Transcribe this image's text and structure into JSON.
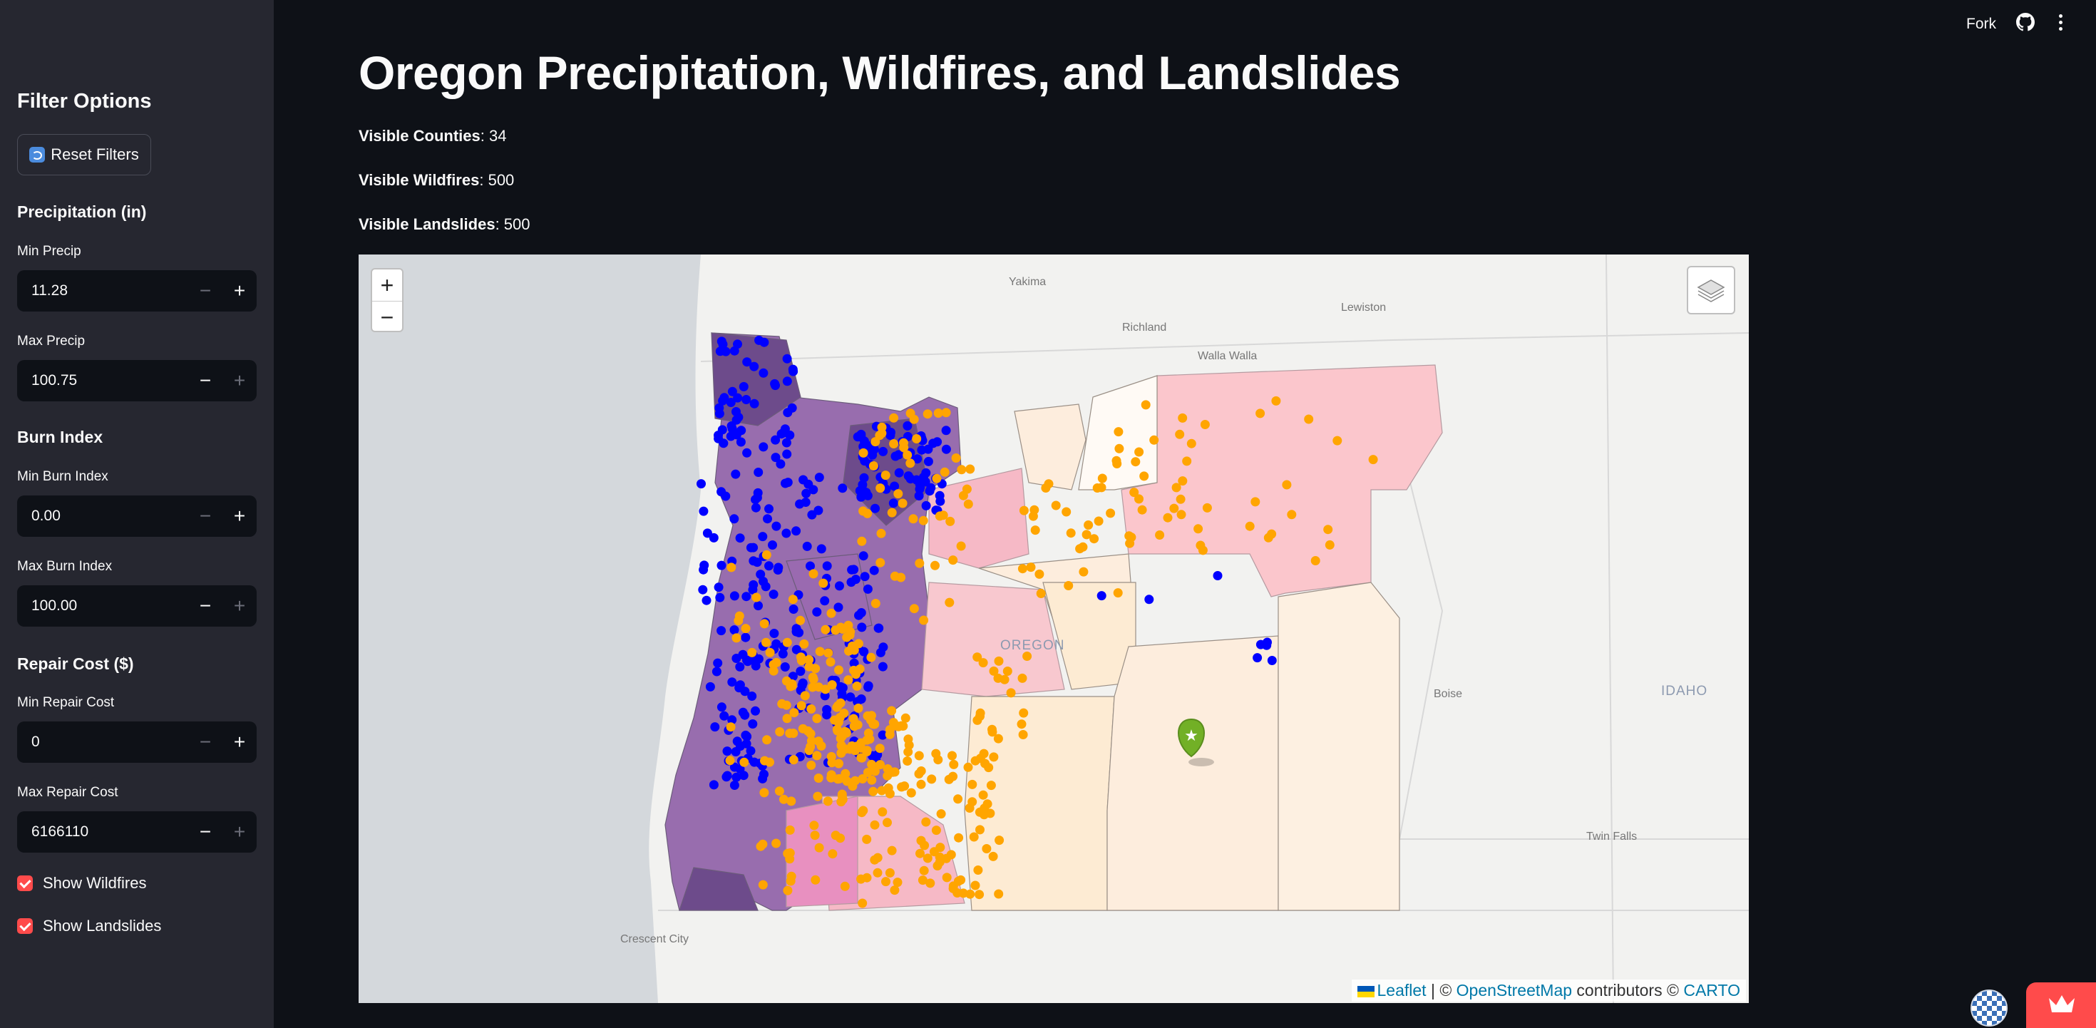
{
  "header": {
    "fork_label": "Fork"
  },
  "sidebar": {
    "title": "Filter Options",
    "reset_label": "Reset Filters",
    "precip": {
      "heading": "Precipitation (in)",
      "min_label": "Min Precip",
      "min_value": "11.28",
      "max_label": "Max Precip",
      "max_value": "100.75"
    },
    "burn": {
      "heading": "Burn Index",
      "min_label": "Min Burn Index",
      "min_value": "0.00",
      "max_label": "Max Burn Index",
      "max_value": "100.00"
    },
    "repair": {
      "heading": "Repair Cost ($)",
      "min_label": "Min Repair Cost",
      "min_value": "0",
      "max_label": "Max Repair Cost",
      "max_value": "6166110"
    },
    "show_wildfires": "Show Wildfires",
    "show_landslides": "Show Landslides"
  },
  "main": {
    "title": "Oregon Precipitation, Wildfires, and Landslides",
    "stats": [
      {
        "label": "Visible Counties",
        "value": "34"
      },
      {
        "label": "Visible Wildfires",
        "value": "500"
      },
      {
        "label": "Visible Landslides",
        "value": "500"
      }
    ]
  },
  "map": {
    "zoom_in": "+",
    "zoom_out": "−",
    "attribution": {
      "leaflet": "Leaflet",
      "sep": "| ©",
      "osm": "OpenStreetMap",
      "contributors": "contributors ©",
      "carto": "CARTO"
    },
    "cities": [
      "Yakima",
      "Richland",
      "Lewiston",
      "Walla Walla",
      "Boise",
      "Twin Falls",
      "Crescent City"
    ],
    "state_labels": [
      "OREGON",
      "IDAHO"
    ],
    "colors": {
      "wildfire_points": "#ffa500",
      "landslide_points": "#0000ff",
      "marker": "#72b026",
      "high_precip": "#7b3f98",
      "mid_precip": "#f4a3b9",
      "low_precip": "#fdebd3"
    }
  },
  "badges": {
    "accent": "#ff4b4b"
  }
}
